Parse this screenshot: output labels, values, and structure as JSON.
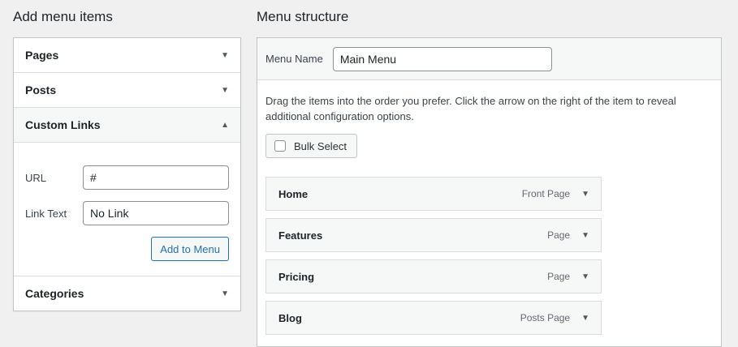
{
  "left": {
    "heading": "Add menu items",
    "sections": [
      {
        "title": "Pages",
        "state": "collapsed"
      },
      {
        "title": "Posts",
        "state": "collapsed"
      },
      {
        "title": "Custom Links",
        "state": "expanded"
      },
      {
        "title": "Categories",
        "state": "collapsed"
      }
    ],
    "custom_links": {
      "url_label": "URL",
      "url_value": "#",
      "link_text_label": "Link Text",
      "link_text_value": "No Link",
      "add_button": "Add to Menu"
    }
  },
  "right": {
    "heading": "Menu structure",
    "menu_name_label": "Menu Name",
    "menu_name_value": "Main Menu",
    "instructions": "Drag the items into the order you prefer. Click the arrow on the right of the item to reveal additional configuration options.",
    "bulk_select": "Bulk Select",
    "items": [
      {
        "title": "Home",
        "type": "Front Page"
      },
      {
        "title": "Features",
        "type": "Page"
      },
      {
        "title": "Pricing",
        "type": "Page"
      },
      {
        "title": "Blog",
        "type": "Posts Page"
      }
    ]
  },
  "icons": {
    "collapsed": "arrow-down-icon",
    "expanded": "arrow-up-icon"
  },
  "colors": {
    "accent": "#2271b1",
    "background": "#f0f0f1",
    "border": "#c3c4c7"
  }
}
